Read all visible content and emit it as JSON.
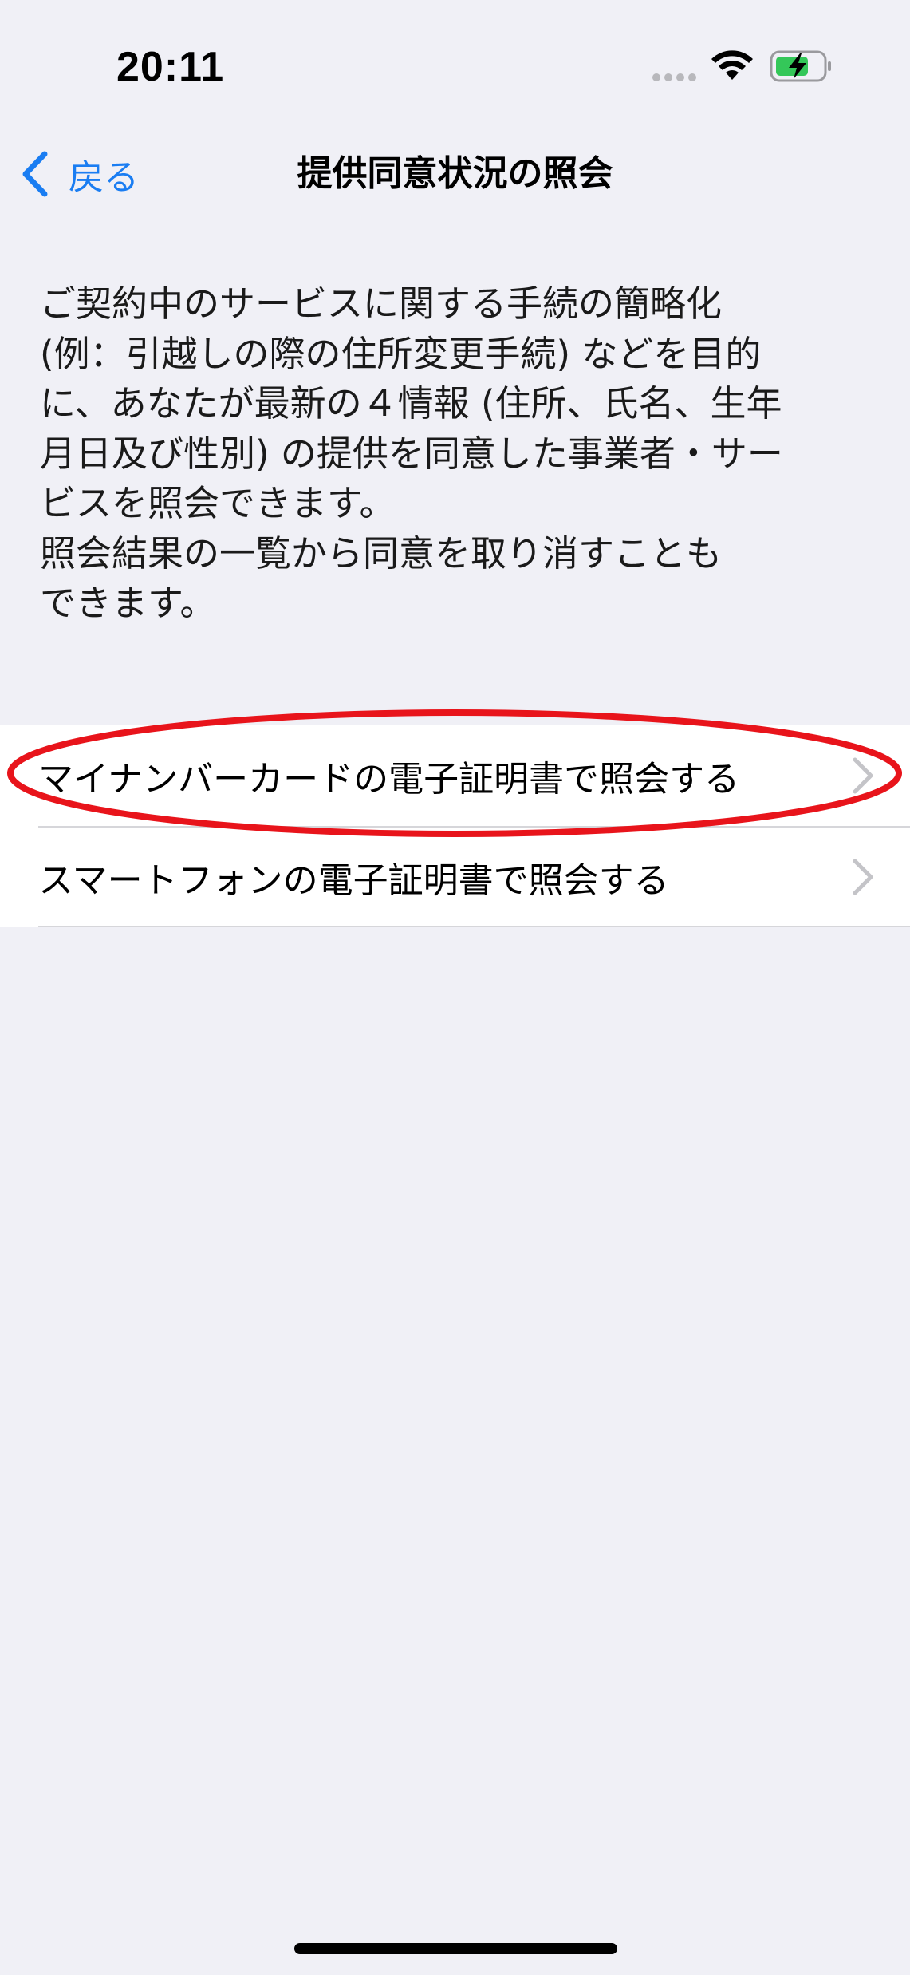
{
  "status_bar": {
    "time": "20:11",
    "icons": [
      "signal-icon",
      "wifi-icon",
      "battery-charging-icon"
    ]
  },
  "nav": {
    "back_label": "戻る",
    "title": "提供同意状況の照会"
  },
  "description": "ご契約中のサービスに関する手続の簡略化\n(例：引越しの際の住所変更手続) などを目的\nに、あなたが最新の４情報 (住所、氏名、生年\n月日及び性別) の提供を同意した事業者・サー\nビスを照会できます。\n照会結果の一覧から同意を取り消すことも\nできます。",
  "list": {
    "items": [
      {
        "label": "マイナンバーカードの電子証明書で照会する",
        "highlighted": true
      },
      {
        "label": "スマートフォンの電子証明書で照会する",
        "highlighted": false
      }
    ]
  },
  "colors": {
    "background": "#f0f0f6",
    "accent": "#1a7df2",
    "highlight": "#e8141b",
    "battery": "#34c759"
  }
}
